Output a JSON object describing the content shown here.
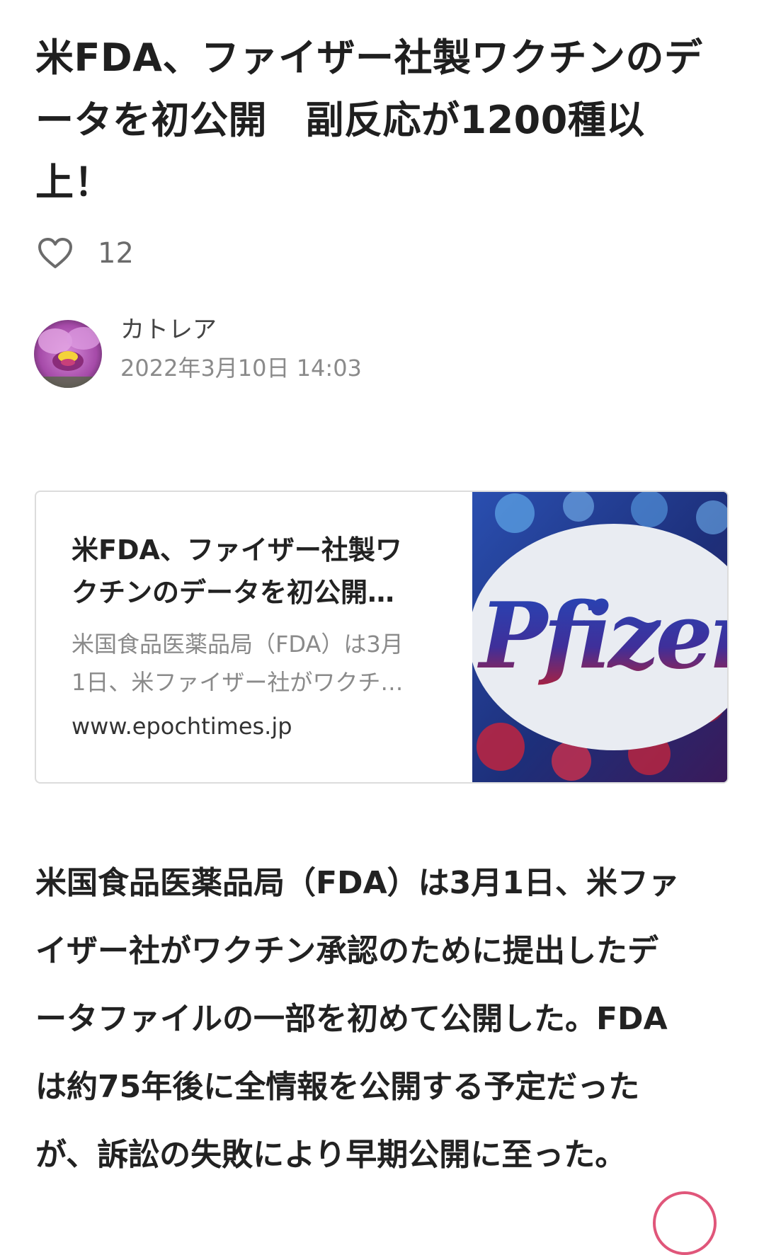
{
  "article": {
    "title": "米FDA、ファイザー社製ワクチンのデ\nータを初公開　副反応が1200種以\n上！",
    "like_count": "12",
    "body": "米国食品医薬品局（FDA）は3月1日、米ファ\nイザー社がワクチン承認のために提出したデ\nータファイルの一部を初めて公開した。FDA\nは約75年後に全情報を公開する予定だった\nが、訴訟の失敗により早期公開に至った。"
  },
  "author": {
    "name": "カトレア",
    "date": "2022年3月10日 14:03"
  },
  "link_card": {
    "title": "米FDA、ファイザー社製ワ\nクチンのデータを初公開…",
    "description": "米国食品医薬品局（FDA）は3月\n1日、米ファイザー社がワクチ…",
    "domain": "www.epochtimes.jp",
    "thumbnail_text": "Pfizer"
  },
  "icons": {
    "like": "heart-outline-icon"
  },
  "colors": {
    "accent": "#e0567a",
    "muted_text": "#8a8a8a",
    "thumb_logo": "#1f3fa0"
  }
}
